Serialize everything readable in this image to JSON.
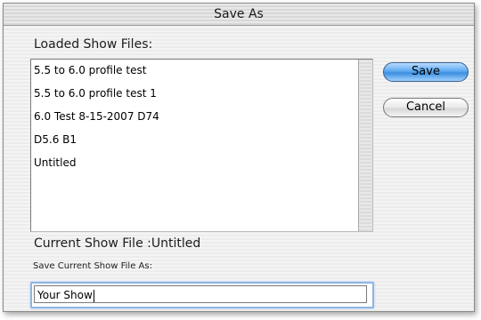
{
  "window": {
    "title": "Save As"
  },
  "loaded_section": {
    "label": "Loaded Show Files:"
  },
  "files": [
    "5.5 to 6.0 profile test",
    "5.5 to 6.0 profile test 1",
    "6.0 Test 8-15-2007 D74",
    "D5.6 B1",
    "Untitled"
  ],
  "buttons": {
    "save": "Save",
    "cancel": "Cancel"
  },
  "current": {
    "label": "Current Show File :Untitled"
  },
  "save_field": {
    "label": "Save Current Show File As:",
    "value": "Your Show"
  }
}
